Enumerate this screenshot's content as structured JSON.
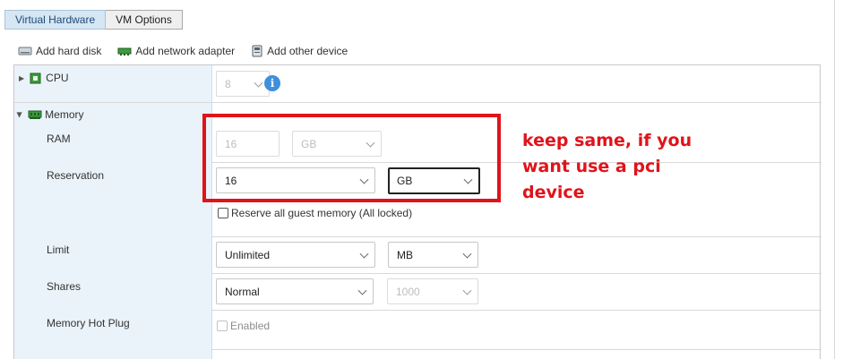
{
  "tabs": [
    {
      "label": "Virtual Hardware",
      "active": true
    },
    {
      "label": "VM Options",
      "active": false
    }
  ],
  "toolbar": {
    "add_hard_disk": "Add hard disk",
    "add_network_adapter": "Add network adapter",
    "add_other_device": "Add other device"
  },
  "cpu": {
    "label": "CPU",
    "value": "8"
  },
  "memory": {
    "label": "Memory",
    "ram": {
      "label": "RAM",
      "value": "16",
      "unit": "GB"
    },
    "reservation": {
      "label": "Reservation",
      "value": "16",
      "unit": "GB"
    },
    "reserve_all": {
      "label": "Reserve all guest memory (All locked)",
      "checked": false
    },
    "limit": {
      "label": "Limit",
      "value": "Unlimited",
      "unit": "MB"
    },
    "shares": {
      "label": "Shares",
      "value": "Normal",
      "amount": "1000"
    },
    "hot_plug": {
      "label": "Memory Hot Plug",
      "option": "Enabled",
      "checked": false
    }
  },
  "annotation": {
    "lines": [
      "keep same, if you",
      "want use a pci",
      "device"
    ],
    "color": "#e0131b"
  }
}
